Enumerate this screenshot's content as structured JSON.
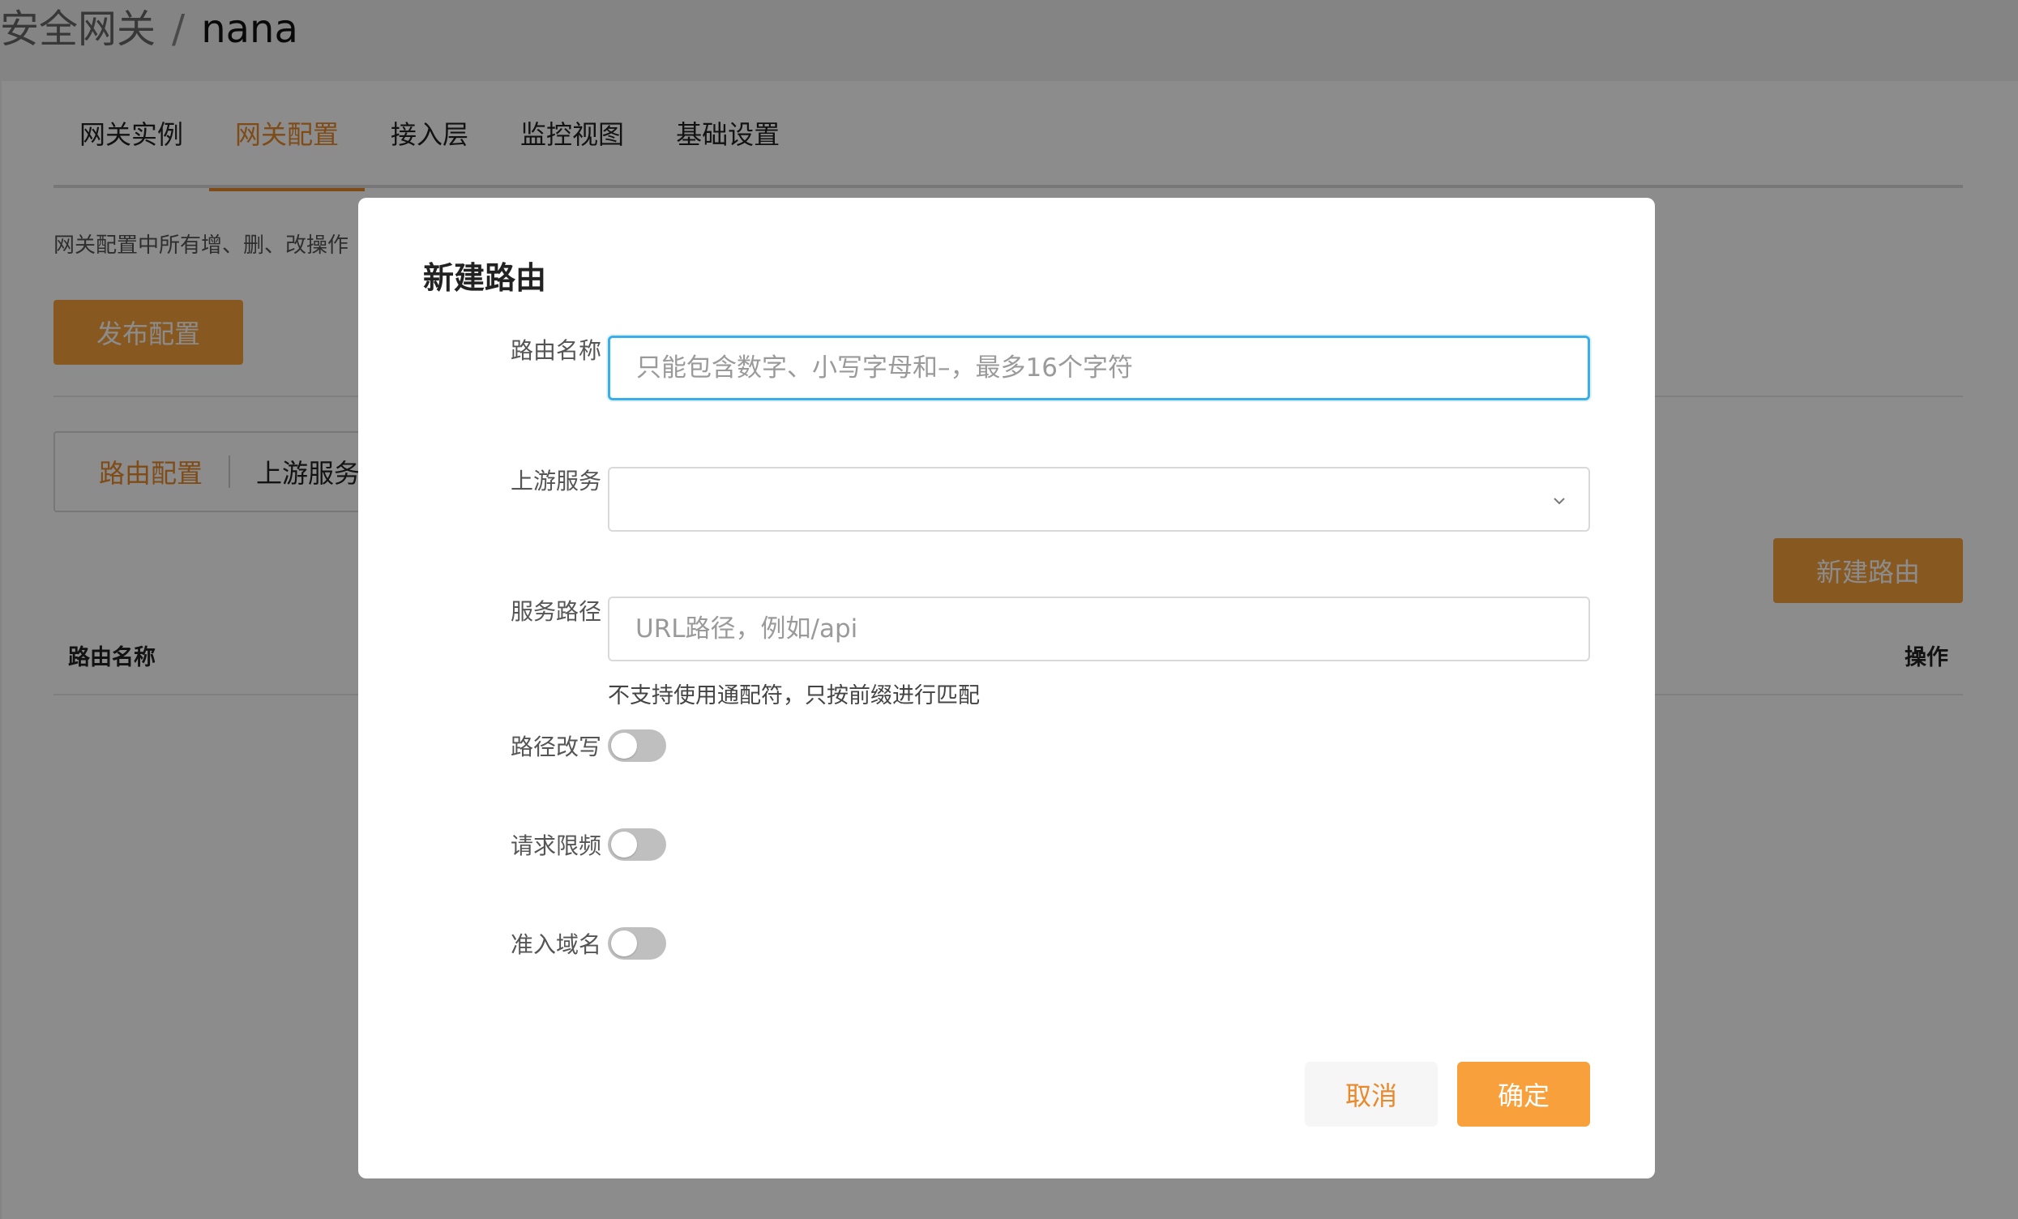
{
  "breadcrumb": {
    "parent": "安全网关",
    "separator": "/",
    "current": "nana"
  },
  "top_tabs": [
    {
      "label": "网关实例",
      "active": false
    },
    {
      "label": "网关配置",
      "active": true
    },
    {
      "label": "接入层",
      "active": false
    },
    {
      "label": "监控视图",
      "active": false
    },
    {
      "label": "基础设置",
      "active": false
    }
  ],
  "config_hint": "网关配置中所有增、删、改操作",
  "publish_button": "发布配置",
  "sub_tabs": [
    {
      "label": "路由配置",
      "active": true
    },
    {
      "label": "上游服务",
      "active": false
    }
  ],
  "new_route_button": "新建路由",
  "table": {
    "columns": [
      "路由名称",
      "操作"
    ]
  },
  "modal": {
    "title": "新建路由",
    "fields": {
      "route_name": {
        "label": "路由名称",
        "value": "",
        "placeholder": "只能包含数字、小写字母和–，最多16个字符"
      },
      "upstream": {
        "label": "上游服务",
        "value": ""
      },
      "service_path": {
        "label": "服务路径",
        "value": "",
        "placeholder": "URL路径，例如/api",
        "help": "不支持使用通配符，只按前缀进行匹配"
      },
      "path_rewrite": {
        "label": "路径改写",
        "enabled": false
      },
      "rate_limit": {
        "label": "请求限频",
        "enabled": false
      },
      "domain_whitelist": {
        "label": "准入域名",
        "enabled": false
      }
    },
    "cancel_label": "取消",
    "confirm_label": "确定"
  },
  "colors": {
    "accent": "#f7a03c",
    "accent_text": "#e8892b",
    "focus": "#3aaee8"
  }
}
